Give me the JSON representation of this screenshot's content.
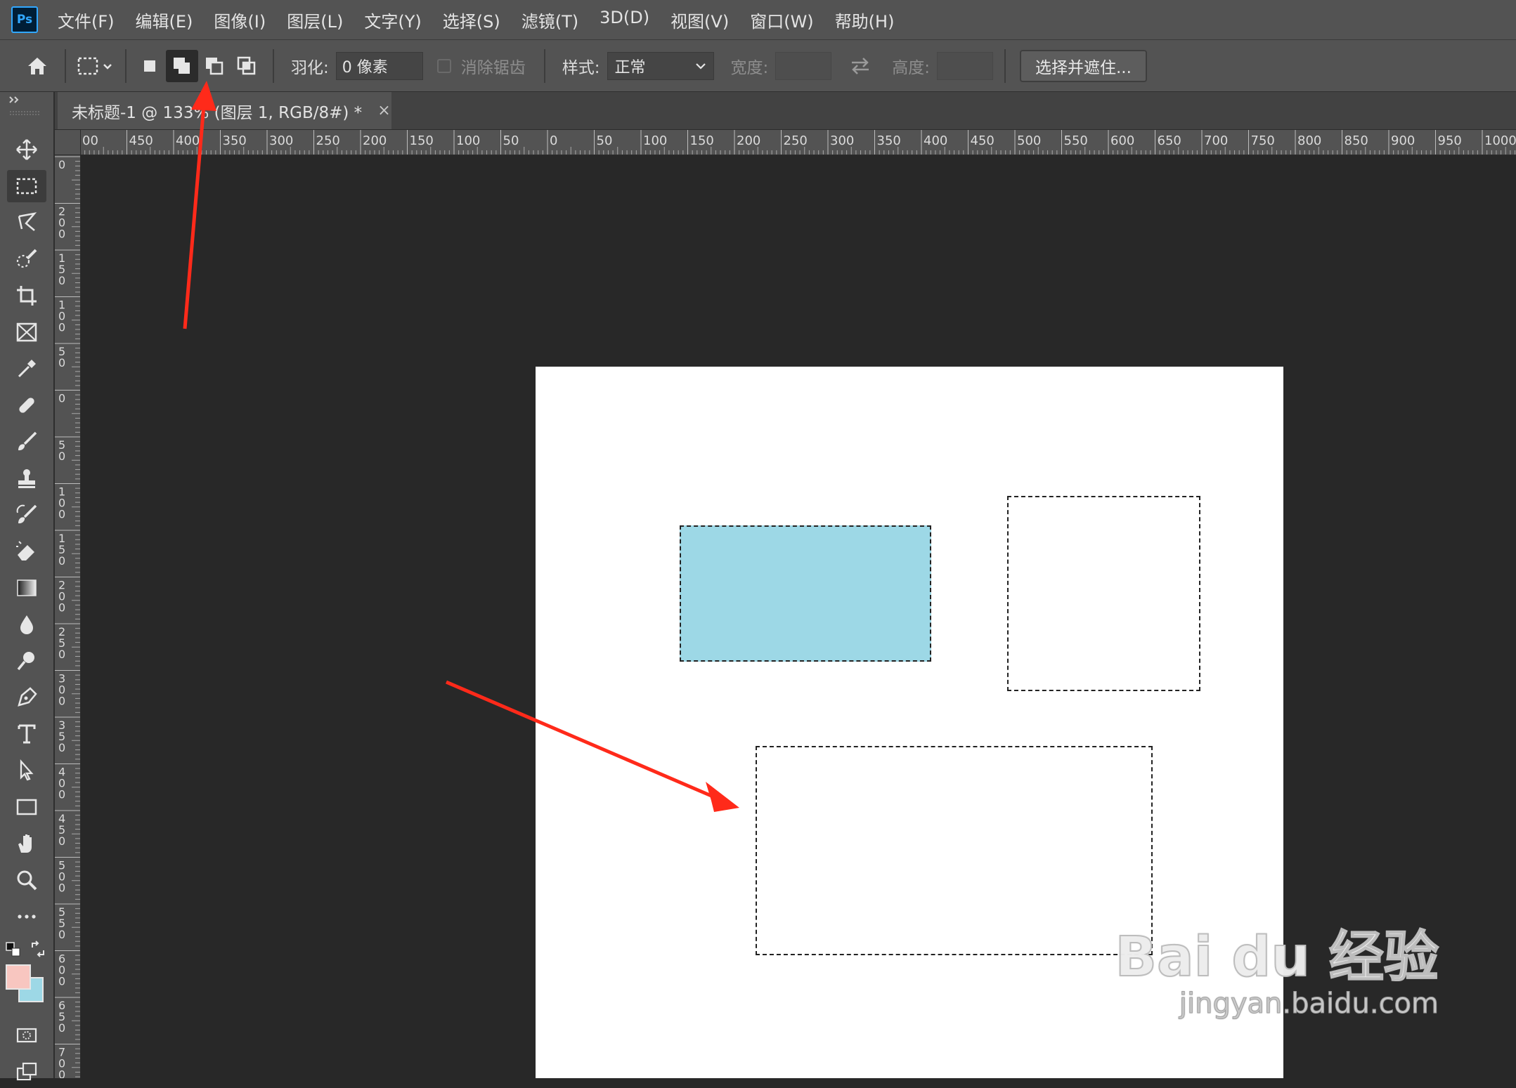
{
  "app": {
    "logo": "Ps"
  },
  "menu": [
    "文件(F)",
    "编辑(E)",
    "图像(I)",
    "图层(L)",
    "文字(Y)",
    "选择(S)",
    "滤镜(T)",
    "3D(D)",
    "视图(V)",
    "窗口(W)",
    "帮助(H)"
  ],
  "options": {
    "feather_label": "羽化:",
    "feather_value": "0 像素",
    "antialias_label": "消除锯齿",
    "style_label": "样式:",
    "style_value": "正常",
    "width_label": "宽度:",
    "height_label": "高度:",
    "select_mask_button": "选择并遮住..."
  },
  "tab": {
    "title": "未标题-1 @ 133% (图层 1, RGB/8#) *",
    "close": "×"
  },
  "ruler_top_labels": [
    "00",
    "450",
    "400",
    "350",
    "300",
    "250",
    "200",
    "150",
    "100",
    "50",
    "0",
    "50",
    "100",
    "150",
    "200",
    "250",
    "300",
    "350",
    "400",
    "450",
    "500",
    "550",
    "600",
    "650",
    "700",
    "750",
    "800",
    "850",
    "900",
    "950",
    "1000"
  ],
  "ruler_left_labels": [
    "0",
    "2\n0\n0",
    "1\n5\n0",
    "1\n0\n0",
    "5\n0",
    "0",
    "5\n0",
    "1\n0\n0",
    "1\n5\n0",
    "2\n0\n0",
    "2\n5\n0",
    "3\n0\n0",
    "3\n5\n0",
    "4\n0\n0",
    "4\n5\n0",
    "5\n0\n0",
    "5\n5\n0",
    "6\n0\n0",
    "6\n5\n0",
    "7\n0\n0"
  ],
  "colors": {
    "foreground": "#f8c6c0",
    "background": "#9dd8e6",
    "shape_fill": "#9dd8e6",
    "arrow": "#ff2a1a"
  },
  "tools": [
    "move-tool",
    "marquee-tool",
    "lasso-tool",
    "quick-select-tool",
    "crop-tool",
    "frame-tool",
    "eyedropper-tool",
    "healing-tool",
    "brush-tool",
    "stamp-tool",
    "history-brush-tool",
    "eraser-tool",
    "gradient-tool",
    "blur-tool",
    "dodge-tool",
    "pen-tool",
    "type-tool",
    "path-select-tool",
    "rectangle-tool",
    "hand-tool",
    "zoom-tool",
    "more-tools"
  ],
  "watermark": {
    "main": "Bai du 经验",
    "sub": "jingyan.baidu.com"
  }
}
